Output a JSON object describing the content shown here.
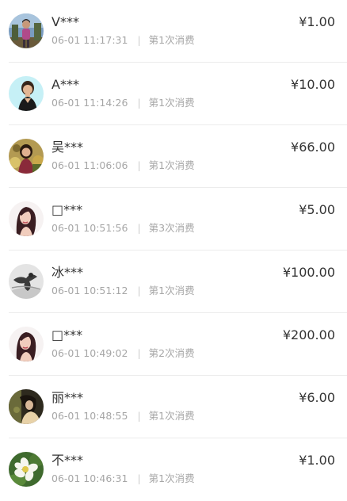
{
  "records": [
    {
      "name": "V***",
      "time": "06-01 11:17:31",
      "count": "第1次消费",
      "amount": "¥1.00",
      "avatar": "avatar-photo-woman-outdoor"
    },
    {
      "name": "A***",
      "time": "06-01 11:14:26",
      "count": "第1次消费",
      "amount": "¥10.00",
      "avatar": "avatar-photo-woman-cyan"
    },
    {
      "name": "吴***",
      "time": "06-01 11:06:06",
      "count": "第1次消费",
      "amount": "¥66.00",
      "avatar": "avatar-photo-woman-flowers"
    },
    {
      "name": "□***",
      "time": "06-01 10:51:56",
      "count": "第3次消费",
      "amount": "¥5.00",
      "avatar": "avatar-photo-woman-portrait"
    },
    {
      "name": "冰***",
      "time": "06-01 10:51:12",
      "count": "第1次消费",
      "amount": "¥100.00",
      "avatar": "avatar-photo-bw-figure"
    },
    {
      "name": "□***",
      "time": "06-01 10:49:02",
      "count": "第2次消费",
      "amount": "¥200.00",
      "avatar": "avatar-photo-woman-portrait"
    },
    {
      "name": "丽***",
      "time": "06-01 10:48:55",
      "count": "第1次消费",
      "amount": "¥6.00",
      "avatar": "avatar-photo-woman-dark"
    },
    {
      "name": "不***",
      "time": "06-01 10:46:31",
      "count": "第1次消费",
      "amount": "¥1.00",
      "avatar": "avatar-photo-white-flower"
    }
  ],
  "separator": "|",
  "colors": {
    "text_primary": "#333333",
    "text_secondary": "#a6a6a6",
    "divider": "#ececec"
  }
}
